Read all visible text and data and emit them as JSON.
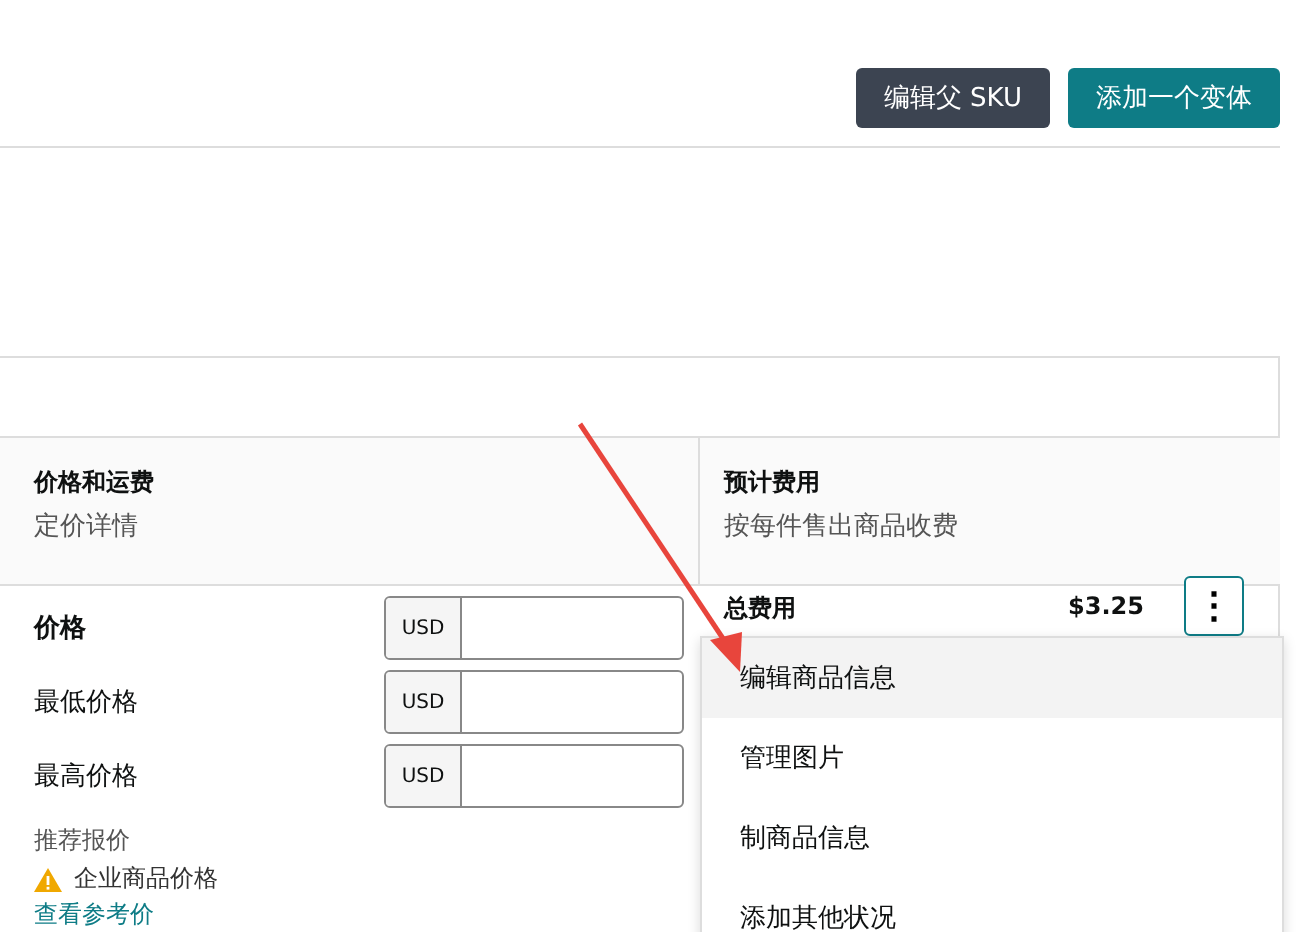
{
  "header_buttons": [
    {
      "label": "编辑父 SKU",
      "kind": "secondary"
    },
    {
      "label": "添加一个变体",
      "kind": "primary"
    }
  ],
  "pricing": {
    "title": "价格和运费",
    "subtitle": "定价详情",
    "fields": [
      {
        "label": "价格",
        "currency": "USD",
        "emphasis": true
      },
      {
        "label": "最低价格",
        "currency": "USD",
        "emphasis": false
      },
      {
        "label": "最高价格",
        "currency": "USD",
        "emphasis": false
      }
    ],
    "recommended_label": "推荐报价",
    "warning": "企业商品价格",
    "link": "查看参考价"
  },
  "fees": {
    "title": "预计费用",
    "subtitle": "按每件售出商品收费",
    "rows": [
      {
        "label": "总费用",
        "amount": "$3.25",
        "bold": true
      }
    ],
    "more_button": "⋮"
  },
  "menu": {
    "items": [
      {
        "label": "编辑商品信息",
        "selected": true
      },
      {
        "label": "管理图片",
        "selected": false
      },
      {
        "label": "制商品信息",
        "selected": false
      },
      {
        "label": "添加其他状况",
        "selected": false
      }
    ]
  }
}
